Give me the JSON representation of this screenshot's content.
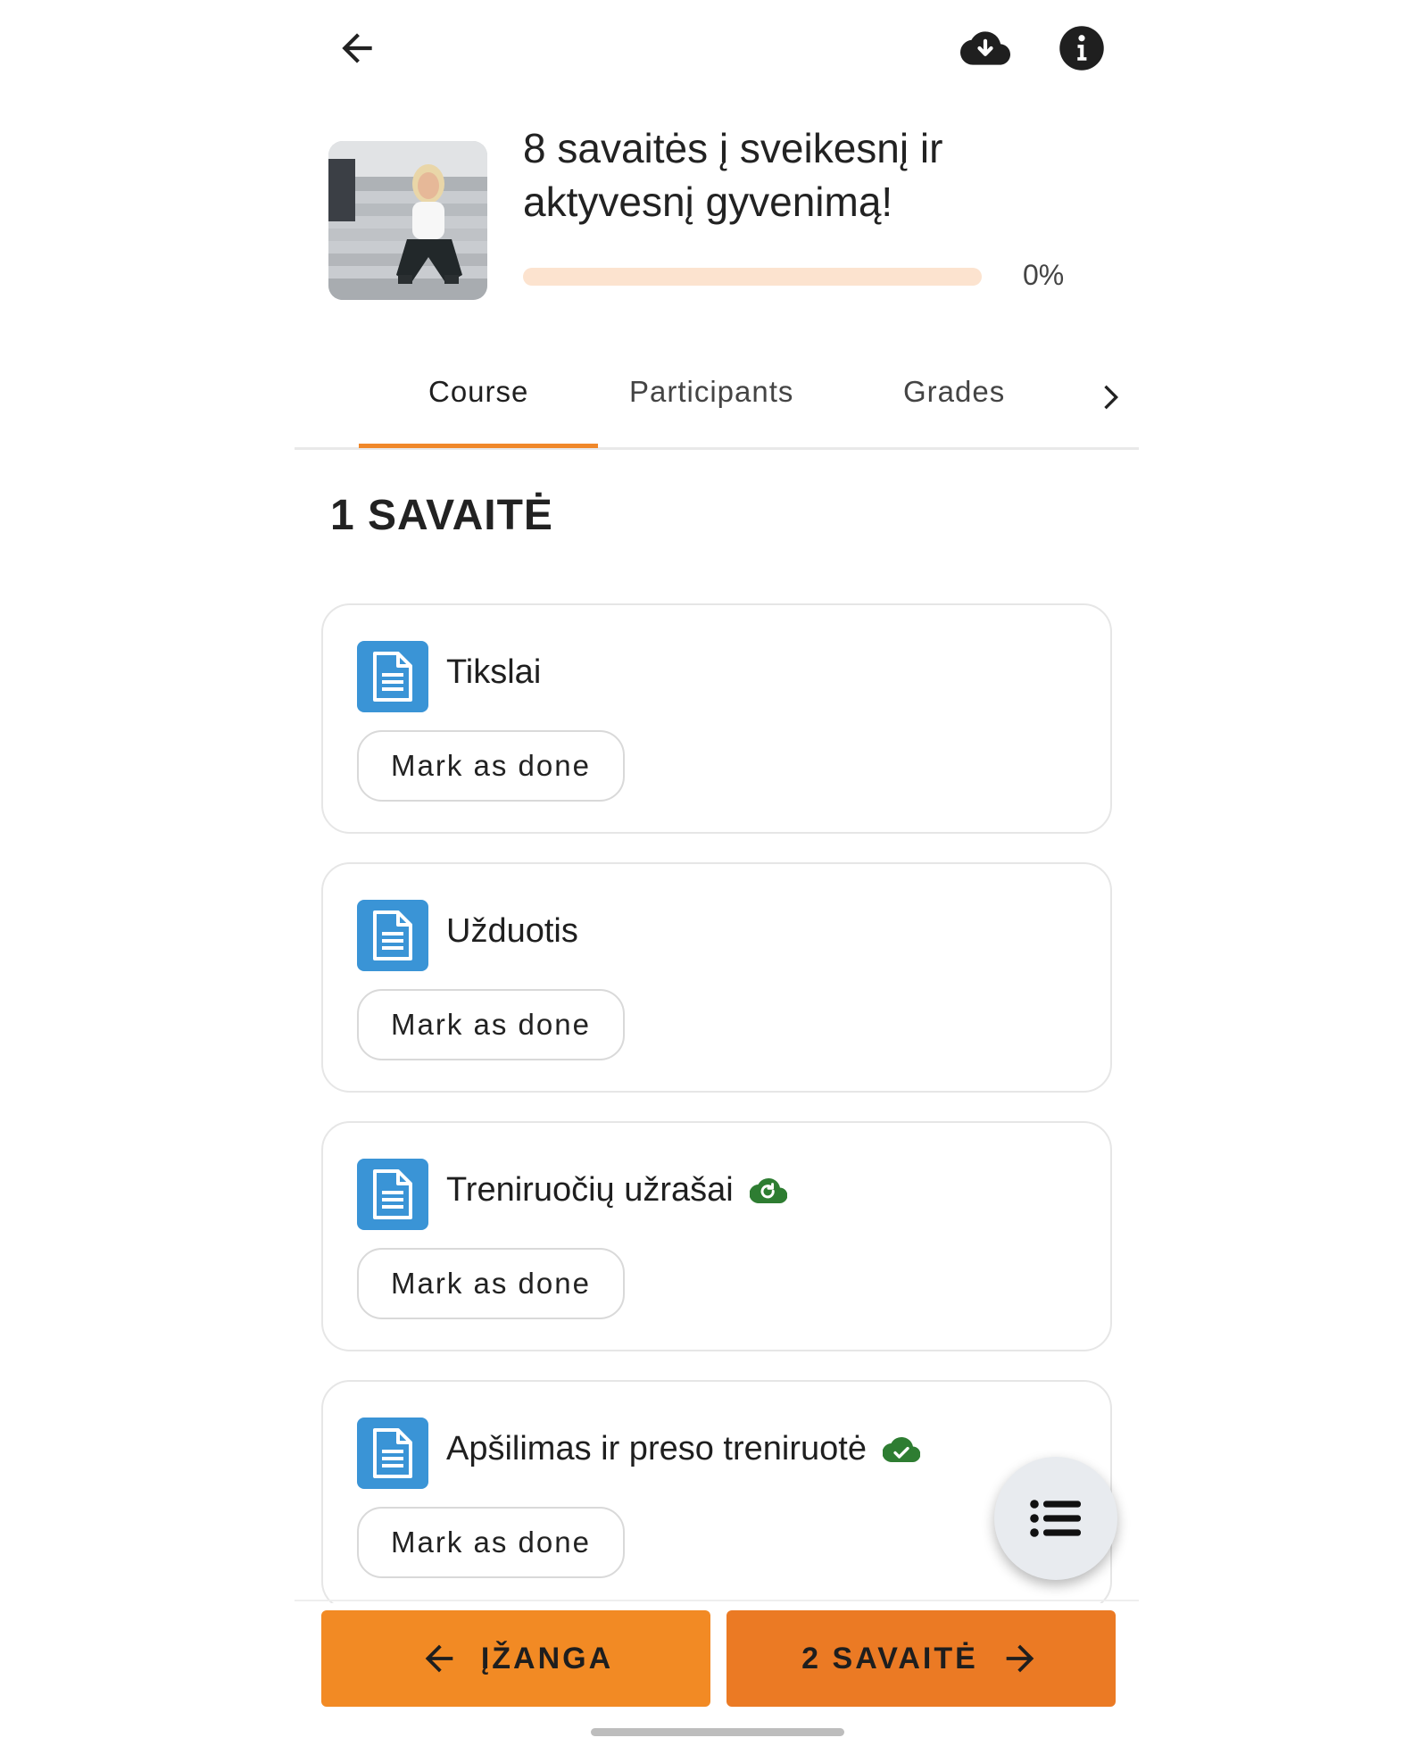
{
  "header": {
    "back_icon": "arrow-left-icon",
    "download_icon": "cloud-download-icon",
    "info_icon": "info-icon"
  },
  "course": {
    "title": "8 savaitės į sveikesnį ir aktyvesnį gyvenimą!",
    "progress_percent": 0,
    "progress_text": "0%"
  },
  "tabs": [
    {
      "label": "Course",
      "active": true
    },
    {
      "label": "Participants",
      "active": false
    },
    {
      "label": "Grades",
      "active": false
    }
  ],
  "section": {
    "heading": "1 SAVAITĖ"
  },
  "activities": [
    {
      "title": "Tikslai",
      "status_icon": null,
      "button": "Mark as done"
    },
    {
      "title": "Užduotis",
      "status_icon": null,
      "button": "Mark as done"
    },
    {
      "title": "Treniruočių užrašai",
      "status_icon": "cloud-sync-icon",
      "button": "Mark as done"
    },
    {
      "title": "Apšilimas ir preso treniruotė",
      "status_icon": "cloud-check-icon",
      "button": "Mark as done"
    }
  ],
  "nav": {
    "prev_label": "ĮŽANGA",
    "next_label": "2 SAVAITĖ"
  },
  "colors": {
    "accent": "#f0882a",
    "progress_track": "#fce3cf",
    "activity_icon": "#3a94d6",
    "status_green": "#2e7d32",
    "prev_button": "#f28a24",
    "next_button": "#eb7a24"
  }
}
